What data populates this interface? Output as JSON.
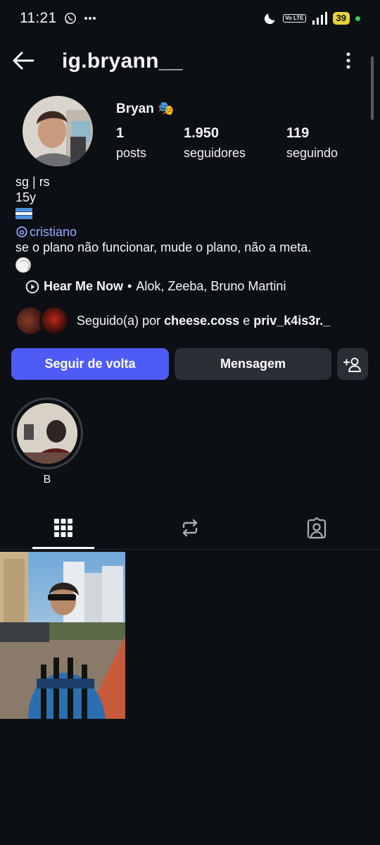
{
  "status_bar": {
    "time": "11:21",
    "volte": "Vo LTE",
    "battery": "39"
  },
  "header": {
    "username": "ig.bryann__"
  },
  "profile": {
    "display_name": "Bryan 🎭",
    "stats": [
      {
        "value": "1",
        "label": "posts"
      },
      {
        "value": "1.950",
        "label": "seguidores"
      },
      {
        "value": "119",
        "label": "seguindo"
      }
    ]
  },
  "bio": {
    "line1": "sg | rs",
    "line2": "15y",
    "mention": "cristiano",
    "line3": "se o plano não funcionar, mude o plano, não a meta."
  },
  "music": {
    "song": "Hear Me Now",
    "separator": "•",
    "artists": "Alok, Zeeba, Bruno Martini"
  },
  "followed_by": {
    "prefix": "Seguido(a) por",
    "user1": "cheese.coss",
    "joiner": "e",
    "user2": "priv_k4is3r._"
  },
  "buttons": {
    "follow_back": "Seguir de volta",
    "message": "Mensagem"
  },
  "highlights": [
    {
      "label": "B"
    }
  ],
  "tabs": {
    "active": "grid",
    "items": [
      "grid-icon",
      "reels-repost-icon",
      "tagged-icon"
    ]
  },
  "colors": {
    "background": "#0c0f14",
    "accent": "#4e5cf5",
    "mention": "#9aa6ff",
    "secondary_button": "#2a2e35"
  }
}
